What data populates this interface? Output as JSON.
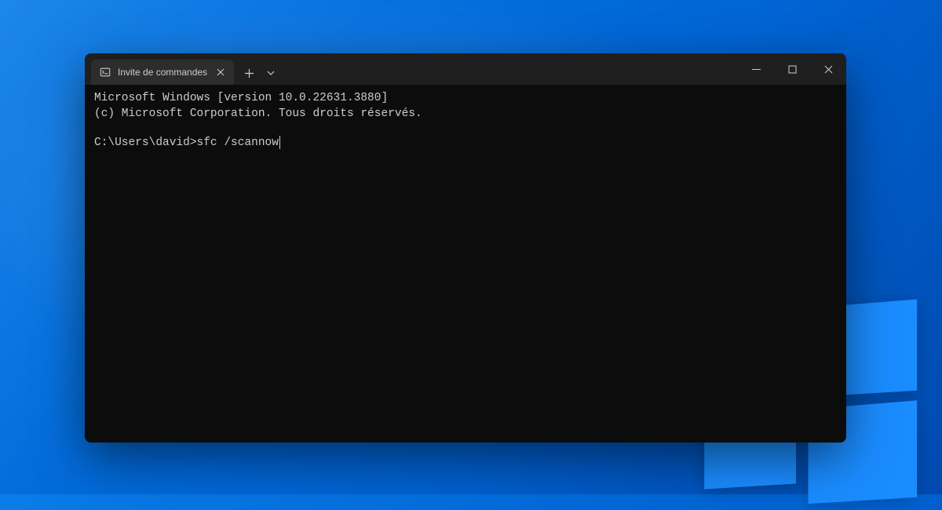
{
  "window": {
    "tab_title": "Invite de commandes",
    "tab_icon": "terminal-icon"
  },
  "terminal": {
    "line1": "Microsoft Windows [version 10.0.22631.3880]",
    "line2": "(c) Microsoft Corporation. Tous droits réservés.",
    "prompt": "C:\\Users\\david>",
    "command": "sfc /scannow"
  }
}
